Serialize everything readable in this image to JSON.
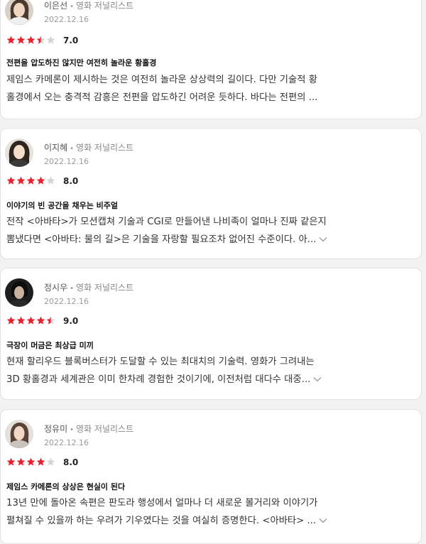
{
  "reviews": [
    {
      "name": "이은선",
      "role": "영화 저널리스트",
      "date": "2022.12.16",
      "rating": 3.5,
      "score": "7.0",
      "headline": "전편을 압도하진 않지만 여전히 놀라운 황홀경",
      "body_line1": "제임스 카메론이 제시하는 것은 여전히 놀라운 상상력의 길이다. 다만 기술적 황",
      "body_line2": "홀경에서 오는 충격적 감흥은 전편을 압도하긴 어려운 듯하다. 바다는 전편의 ..."
    },
    {
      "name": "이지혜",
      "role": "영화 저널리스트",
      "date": "2022.12.16",
      "rating": 4,
      "score": "8.0",
      "headline": "이야기의 빈 공간을 채우는 비주얼",
      "body_line1": "전작 <아바타>가 모션캡쳐 기술과 CGI로 만들어낸 나비족이 얼마나 진짜 같은지",
      "body_line2": "뽐냈다면 <아바타: 물의 길>은 기술을 자랑할 필요조차 없어진 수준이다. 아..."
    },
    {
      "name": "정시우",
      "role": "영화 저널리스트",
      "date": "2022.12.16",
      "rating": 4.5,
      "score": "9.0",
      "headline": "극장이 머금은 최상급 미끼",
      "body_line1": "현재 할리우드 블록버스터가 도달할 수 있는 최대치의 기술력. 영화가 그려내는",
      "body_line2": "3D 황홀경과 세계관은 이미 한차례 경험한 것이기에, 이전처럼 대다수 대중..."
    },
    {
      "name": "정유미",
      "role": "영화 저널리스트",
      "date": "2022.12.16",
      "rating": 4,
      "score": "8.0",
      "headline": "제임스 카메론의 상상은 현실이 된다",
      "body_line1": "13년 만에 돌아온 속편은 판도라 행성에서 얼마나 더 새로운 볼거리와 이야기가",
      "body_line2": "펼쳐질 수 있을까 하는 우려가 기우였다는 것을 여실히 증명한다. <아바타> ..."
    }
  ],
  "colors": {
    "star_filled": "#e8212e",
    "star_empty": "#d4d4d4"
  },
  "icons": {
    "more": "chevron-down-icon",
    "rating": "star-icon",
    "avatar": "avatar"
  }
}
